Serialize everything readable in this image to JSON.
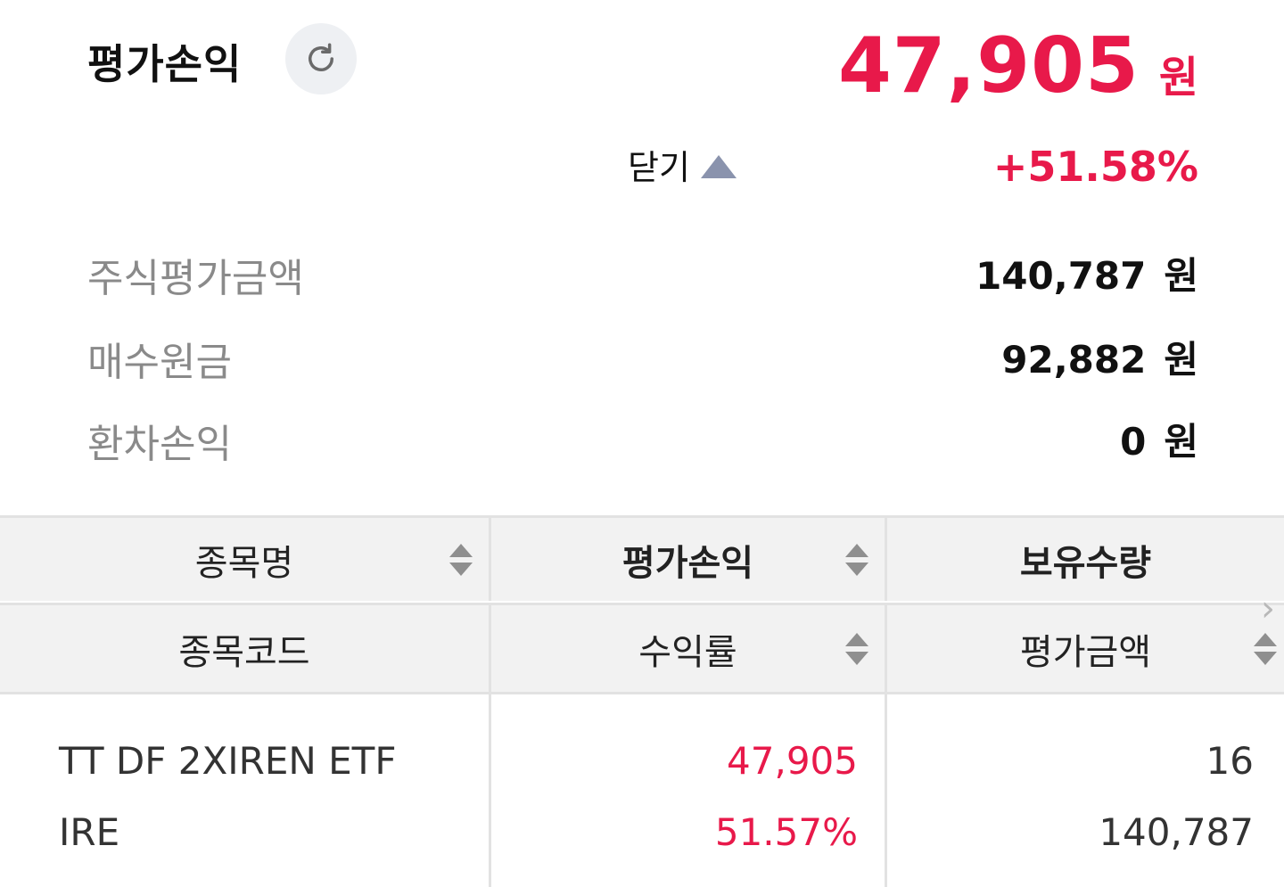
{
  "summary": {
    "title": "평가손익",
    "pl_amount": "47,905",
    "pl_unit": "원",
    "collapse_label": "닫기",
    "pl_rate": "+51.58%",
    "rows": [
      {
        "label": "주식평가금액",
        "value": "140,787",
        "unit": "원"
      },
      {
        "label": "매수원금",
        "value": "92,882",
        "unit": "원"
      },
      {
        "label": "환차손익",
        "value": "0",
        "unit": "원"
      }
    ]
  },
  "table": {
    "header_row1": [
      "종목명",
      "평가손익",
      "보유수량"
    ],
    "header_row2": [
      "종목코드",
      "수익률",
      "평가금액"
    ],
    "rows": [
      {
        "name": "TT DF 2XIREN ETF",
        "code": "IRE",
        "pl": "47,905",
        "rate": "51.57%",
        "quantity": "16",
        "eval_amount": "140,787"
      }
    ]
  },
  "colors": {
    "accent": "#e8194a",
    "muted": "#8a8a8a",
    "header_bg": "#f2f2f2"
  },
  "icons": {
    "refresh": "refresh-icon",
    "collapse": "caret-up-icon",
    "sort": "sort-icon",
    "next": "chevron-right-icon"
  }
}
